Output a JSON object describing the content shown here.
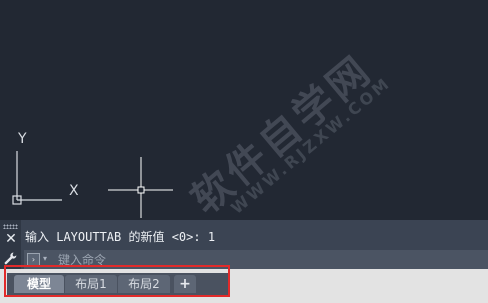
{
  "drawing": {
    "background_color": "#222833",
    "ucs_icon": {
      "y_label": "Y",
      "x_label": "X"
    },
    "watermark": {
      "main_text": "软件自学网",
      "url_text": "WWW.RJZXW.COM"
    }
  },
  "command_line": {
    "history_text": "输入 LAYOUTTAB 的新值 <0>: 1",
    "input_placeholder": "键入命令",
    "close_icon": "close-icon",
    "customize_icon": "wrench-icon",
    "prompt_icon": "command-prompt-icon",
    "dropdown_icon": "chevron-down-icon"
  },
  "layout_tabs": {
    "tabs": [
      {
        "label": "模型",
        "active": true
      },
      {
        "label": "布局1",
        "active": false
      },
      {
        "label": "布局2",
        "active": false
      }
    ],
    "add_label": "+"
  },
  "annotation": {
    "highlight_color": "#e22a2a"
  }
}
